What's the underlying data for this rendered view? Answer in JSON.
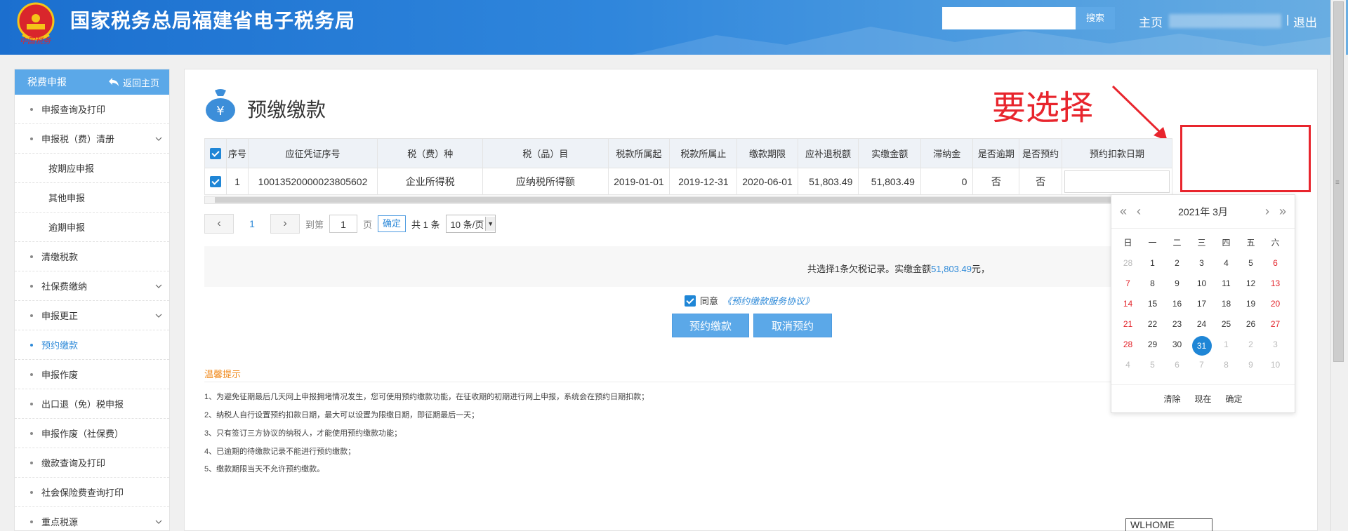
{
  "header": {
    "site_title": "国家税务总局福建省电子税务局",
    "emblem_text": "中国税务",
    "search_placeholder": "",
    "search_button": "搜索",
    "nav_home": "主页",
    "nav_separator": "|",
    "nav_logout": "退出"
  },
  "sidebar": {
    "header_label": "税费申报",
    "back_label": "返回主页",
    "items": [
      {
        "label": "申报查询及打印"
      },
      {
        "label": "申报税（费）清册"
      },
      {
        "label": "按期应申报"
      },
      {
        "label": "其他申报"
      },
      {
        "label": "逾期申报"
      },
      {
        "label": "清缴税款"
      },
      {
        "label": "社保费缴纳"
      },
      {
        "label": "申报更正"
      },
      {
        "label": "预约缴款"
      },
      {
        "label": "申报作废"
      },
      {
        "label": "出口退（免）税申报"
      },
      {
        "label": "申报作废（社保费）"
      },
      {
        "label": "缴款查询及打印"
      },
      {
        "label": "社会保险费查询打印"
      },
      {
        "label": "重点税源"
      }
    ]
  },
  "main": {
    "page_title": "预缴缴款",
    "annotation": "要选择",
    "table": {
      "headers": [
        "序号",
        "应征凭证序号",
        "税（费）种",
        "税（品）目",
        "税款所属起",
        "税款所属止",
        "缴款期限",
        "应补退税额",
        "实缴金额",
        "滞纳金",
        "是否逾期",
        "是否预约",
        "预约扣款日期"
      ],
      "rows": [
        [
          "1",
          "10013520000023805602",
          "企业所得税",
          "应纳税所得额",
          "2019-01-01",
          "2019-12-31",
          "2020-06-01",
          "51,803.49",
          "51,803.49",
          "0",
          "否",
          "否"
        ]
      ]
    },
    "pager": {
      "current": "1",
      "goto_label": "到第",
      "goto_value": "1",
      "page_unit": "页",
      "confirm": "确定",
      "total": "共 1 条",
      "per_page": "10 条/页"
    },
    "summary": {
      "prefix": "共选择1条欠税记录。实缴金额",
      "amount": "51,803.49",
      "suffix": "元，"
    },
    "agree": {
      "label": "同意",
      "link": "《预约缴款服务协议》"
    },
    "buttons": {
      "reserve": "预约缴款",
      "cancel": "取消预约"
    },
    "tips": {
      "title": "温馨提示",
      "lines": [
        "1、为避免征期最后几天网上申报拥堵情况发生，您可使用预约缴款功能，在征收期的初期进行网上申报，系统会在预约日期扣款；",
        "2、纳税人自行设置预约扣款日期，最大可以设置为限缴日期，即征期最后一天；",
        "3、只有签订三方协议的纳税人，才能使用预约缴款功能；",
        "4、已逾期的待缴款记录不能进行预约缴款；",
        "5、缴款期限当天不允许预约缴款。"
      ]
    },
    "watermark": "WLHOME"
  },
  "calendar": {
    "year_label": "2021年",
    "month_label": "3月",
    "weekdays": [
      "日",
      "一",
      "二",
      "三",
      "四",
      "五",
      "六"
    ],
    "days": [
      [
        "28",
        "1",
        "2",
        "3",
        "4",
        "5",
        "6"
      ],
      [
        "7",
        "8",
        "9",
        "10",
        "11",
        "12",
        "13"
      ],
      [
        "14",
        "15",
        "16",
        "17",
        "18",
        "19",
        "20"
      ],
      [
        "21",
        "22",
        "23",
        "24",
        "25",
        "26",
        "27"
      ],
      [
        "28",
        "29",
        "30",
        "31",
        "1",
        "2",
        "3"
      ],
      [
        "4",
        "5",
        "6",
        "7",
        "8",
        "9",
        "10"
      ]
    ],
    "selected": "31",
    "footer": {
      "clear": "清除",
      "now": "现在",
      "confirm": "确定"
    }
  },
  "colors": {
    "accent": "#1f86d6",
    "header_blue": "#2f86dc",
    "annotation_red": "#e8252d",
    "tips_orange": "#f08a1c"
  }
}
